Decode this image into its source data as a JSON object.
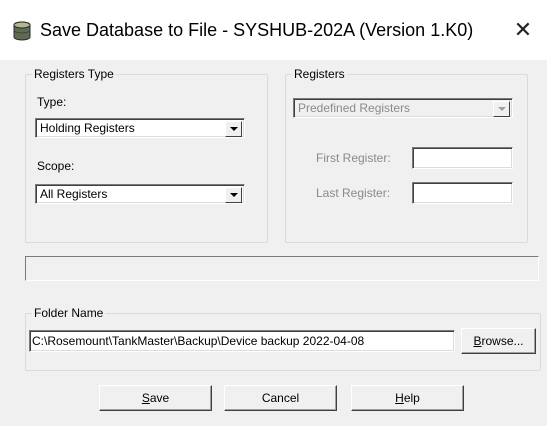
{
  "window": {
    "title": "Save Database to File - SYSHUB-202A (Version 1.K0)",
    "app_icon": "database-icon",
    "close_icon": "close-icon",
    "close_glyph": "✕"
  },
  "registers_type": {
    "legend": "Registers Type",
    "type_label": "Type:",
    "type_value": "Holding Registers",
    "scope_label": "Scope:",
    "scope_value": "All Registers"
  },
  "registers": {
    "legend": "Registers",
    "predefined_value": "Predefined Registers",
    "first_label": "First Register:",
    "first_value": "",
    "last_label": "Last Register:",
    "last_value": ""
  },
  "status": {
    "text": ""
  },
  "folder": {
    "legend": "Folder Name",
    "path": "C:\\Rosemount\\TankMaster\\Backup\\Device backup 2022-04-08",
    "browse_label_accel": "B",
    "browse_label_rest": "rowse..."
  },
  "buttons": {
    "save_accel": "S",
    "save_rest": "ave",
    "cancel": "Cancel",
    "help_accel": "H",
    "help_rest": "elp"
  }
}
